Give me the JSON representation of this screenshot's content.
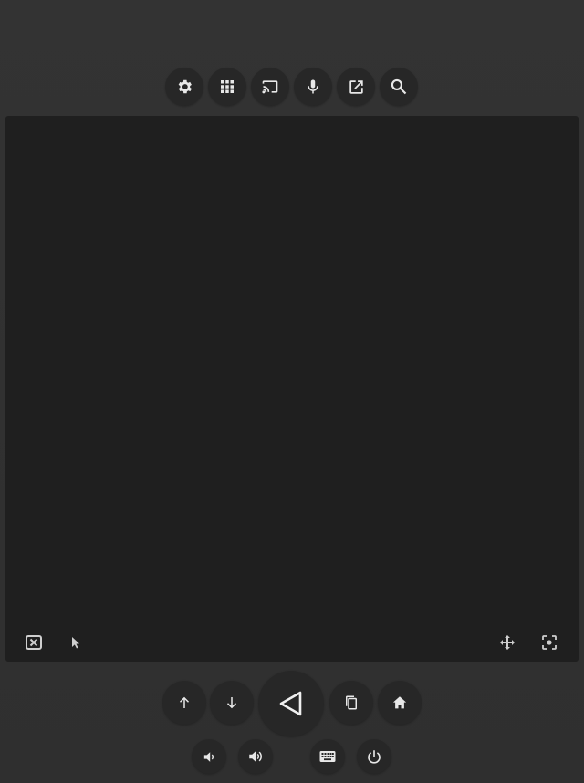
{
  "colors": {
    "background": "#313131",
    "screen": "#1f1f1f",
    "button": "#272727",
    "icon": "#e0e0e0"
  },
  "toolbar": {
    "icons": [
      "settings-icon",
      "apps-grid-icon",
      "cast-icon",
      "microphone-icon",
      "open-external-icon",
      "search-icon"
    ]
  },
  "screen_overlay": {
    "icons": [
      "close-box-icon",
      "pointer-icon",
      "move-icon",
      "screenshot-icon"
    ]
  },
  "navigation": {
    "icons": [
      "arrow-up-icon",
      "arrow-down-icon",
      "back-triangle-icon",
      "overview-icon",
      "home-icon"
    ]
  },
  "system": {
    "icons": [
      "volume-down-icon",
      "volume-up-icon",
      "keyboard-icon",
      "power-icon"
    ]
  }
}
